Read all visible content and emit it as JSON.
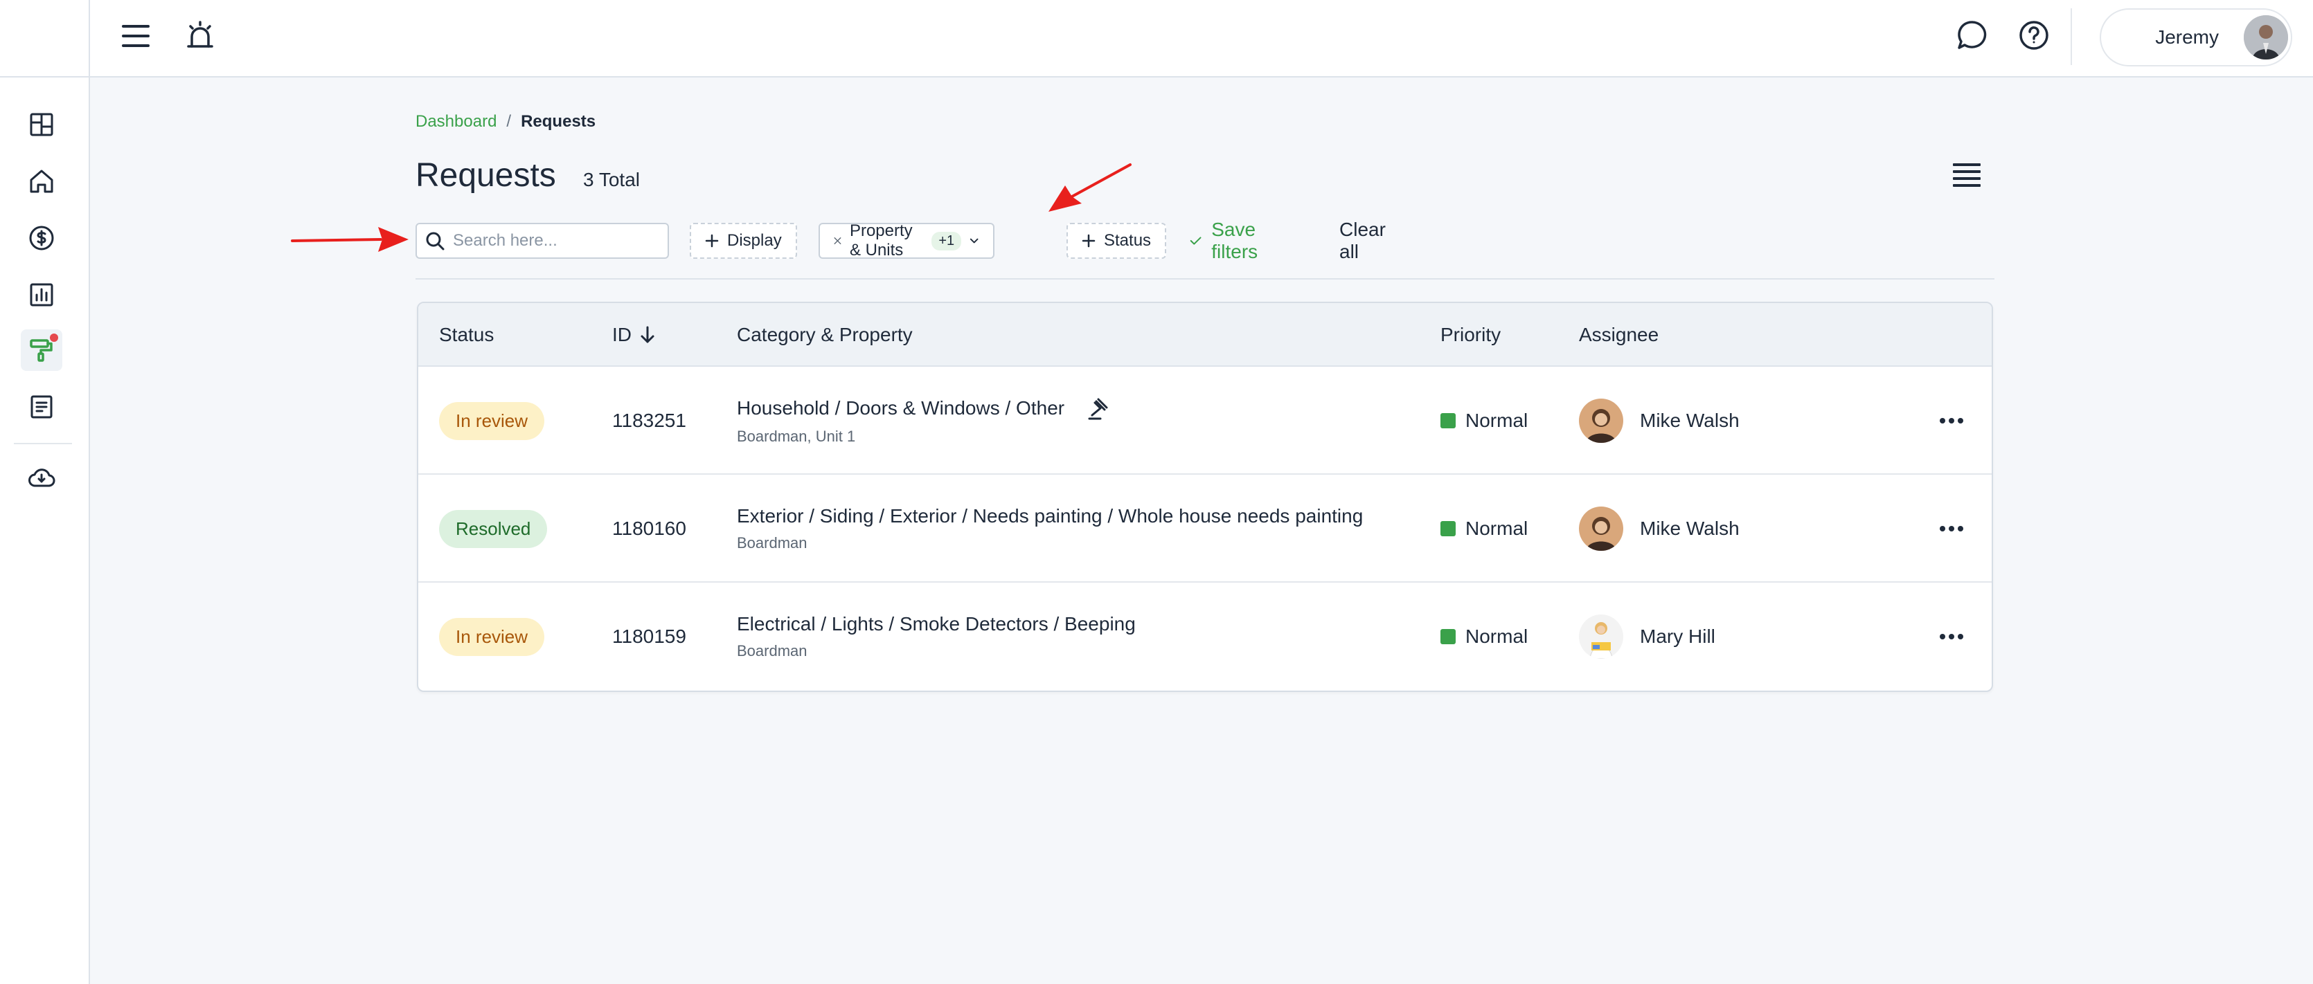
{
  "header": {
    "user_name": "Jeremy"
  },
  "icons": {
    "menu": "hamburger-menu-icon",
    "alarm": "emergency-alarm-icon",
    "chat": "chat-bubble-icon",
    "help": "question-circle-icon"
  },
  "sidebar": {
    "items": [
      {
        "icon": "dashboard-grid-icon"
      },
      {
        "icon": "home-icon"
      },
      {
        "icon": "dollar-circle-icon"
      },
      {
        "icon": "bar-chart-icon"
      },
      {
        "icon": "paint-roller-icon",
        "active": true,
        "notification": true
      },
      {
        "icon": "document-icon"
      },
      {
        "icon": "cloud-download-icon"
      }
    ]
  },
  "breadcrumb": {
    "parent": "Dashboard",
    "separator": "/",
    "current": "Requests"
  },
  "page": {
    "title": "Requests",
    "total": "3 Total"
  },
  "filters": {
    "search_placeholder": "Search here...",
    "display_label": "Display",
    "property_units_label": "Property & Units",
    "property_units_count": "+1",
    "status_label": "Status",
    "save_filters_label": "Save filters",
    "clear_all_label": "Clear all"
  },
  "table": {
    "columns": {
      "status": "Status",
      "id": "ID",
      "category": "Category & Property",
      "priority": "Priority",
      "assignee": "Assignee"
    },
    "rows": [
      {
        "status": "In review",
        "id": "1183251",
        "category": "Household / Doors & Windows / Other",
        "property": "Boardman, Unit 1",
        "priority": "Normal",
        "assignee": "Mike Walsh",
        "has_gavel": true
      },
      {
        "status": "Resolved",
        "id": "1180160",
        "category": "Exterior / Siding / Exterior / Needs painting / Whole house needs painting",
        "property": "Boardman",
        "priority": "Normal",
        "assignee": "Mike Walsh",
        "has_gavel": false
      },
      {
        "status": "In review",
        "id": "1180159",
        "category": "Electrical / Lights / Smoke Detectors / Beeping",
        "property": "Boardman",
        "priority": "Normal",
        "assignee": "Mary Hill",
        "has_gavel": false
      }
    ]
  },
  "colors": {
    "accent_green": "#3aa14a",
    "priority_normal": "#3aa14a",
    "in_review_bg": "#fdf1c7",
    "in_review_fg": "#a8570a",
    "resolved_bg": "#dcf1df",
    "resolved_fg": "#1e6b2a",
    "annotation_arrow": "#e8201d"
  }
}
